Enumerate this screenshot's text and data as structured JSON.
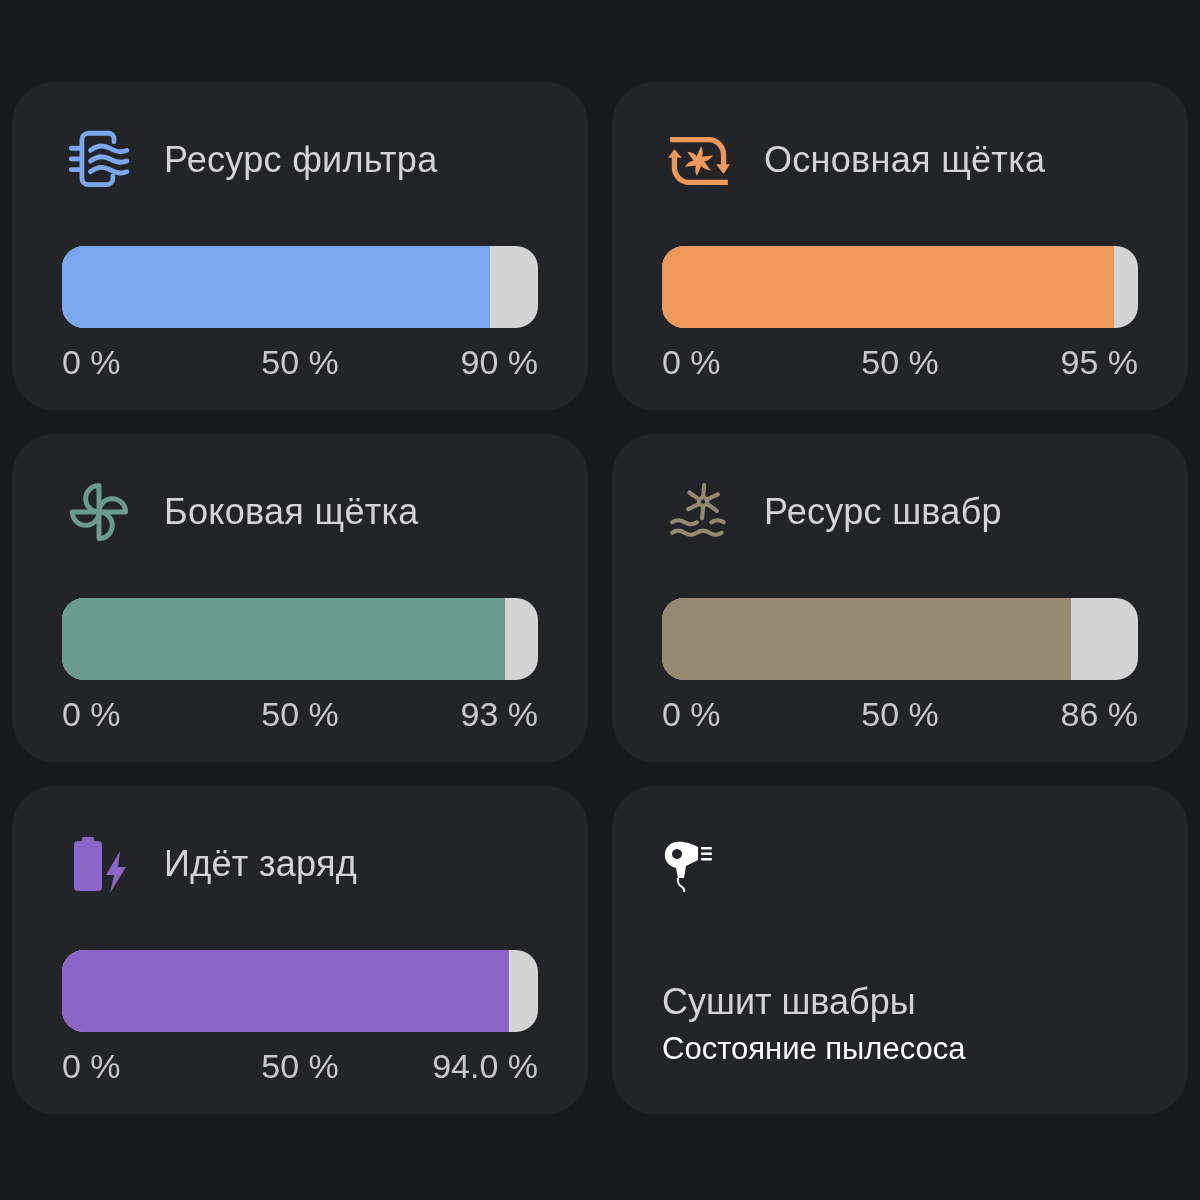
{
  "cards": [
    {
      "kind": "gauge",
      "title": "Ресурс фильтра",
      "color": "#7aa7ee",
      "level": 0.9,
      "scale": [
        "0 %",
        "50 %",
        "90 %"
      ]
    },
    {
      "kind": "gauge",
      "title": "Основная щётка",
      "color": "#ee985a",
      "level": 0.95,
      "scale": [
        "0 %",
        "50 %",
        "95 %"
      ]
    },
    {
      "kind": "gauge",
      "title": "Боковая щётка",
      "color": "#6a9a91",
      "level": 0.93,
      "scale": [
        "0 %",
        "50 %",
        "93 %"
      ]
    },
    {
      "kind": "gauge",
      "title": "Ресурс швабр",
      "color": "#948a6f",
      "level": 0.86,
      "scale": [
        "0 %",
        "50 %",
        "86 %"
      ]
    },
    {
      "kind": "gauge",
      "title": "Идёт заряд",
      "color": "#8b66c9",
      "level": 0.94,
      "scale": [
        "0 %",
        "50 %",
        "94.0 %"
      ]
    },
    {
      "kind": "status",
      "value": "Сушит швабры",
      "label": "Состояние пылесоса"
    }
  ]
}
